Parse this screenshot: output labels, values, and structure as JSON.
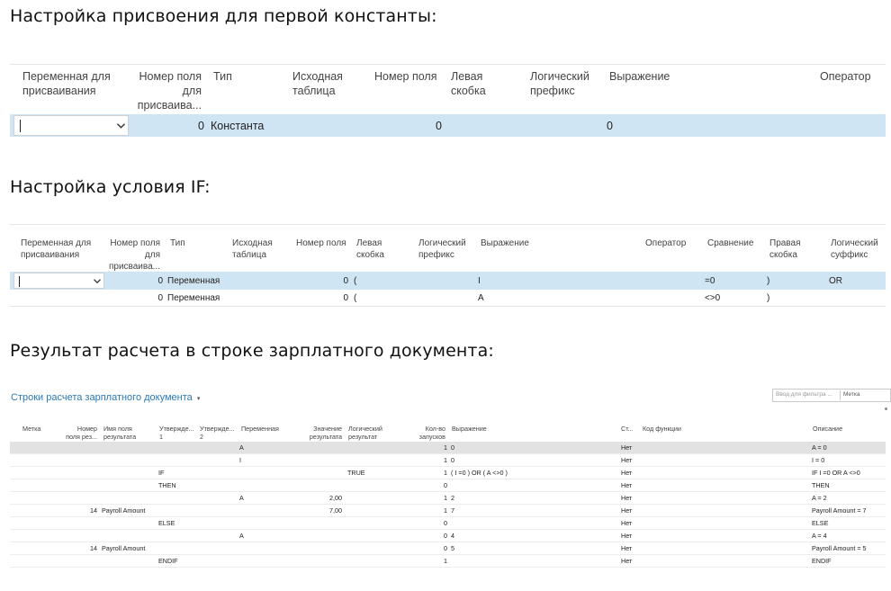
{
  "section1": {
    "heading": "Настройка присвоения для первой константы:",
    "headers": {
      "col1": "Переменная для\nприсваивания",
      "col2": "Номер поля\nдля\nприсваива...",
      "col3": "Тип",
      "col4": "Исходная\nтаблица",
      "col5": "Номер поля",
      "col6": "Левая\nскобка",
      "col7": "Логический\nпрефикс",
      "col8": "Выражение",
      "col9": "Оператор"
    },
    "row": {
      "var": "",
      "field": "0",
      "type": "Константа",
      "field2": "0",
      "expr": "0"
    }
  },
  "section2": {
    "heading": "Настройка условия IF:",
    "headers": {
      "col1": "Переменная для\nприсваивания",
      "col2": "Номер поля\nдля\nприсваива...",
      "col3": "Тип",
      "col4": "Исходная\nтаблица",
      "col5": "Номер поля",
      "col6": "Левая\nскобка",
      "col7": "Логический\nпрефикс",
      "col8": "Выражение",
      "col9": "Оператор",
      "col10": "Сравнение",
      "col11": "Правая\nскобка",
      "col12": "Логический\nсуффикс"
    },
    "rows": [
      {
        "var": "",
        "field": "0",
        "type": "Переменная",
        "field2": "0",
        "lbr": "(",
        "expr": "I",
        "cmp": "=0",
        "rbr": ")",
        "suffix": "OR"
      },
      {
        "var": "",
        "field": "0",
        "type": "Переменная",
        "field2": "0",
        "lbr": "(",
        "expr": "A",
        "cmp": "<>0",
        "rbr": ")",
        "suffix": ""
      }
    ]
  },
  "section3": {
    "heading": "Результат расчета в строке зарплатного документа:",
    "link": "Строки расчета зарплатного документа",
    "filter_placeholder": "Ввод для фильтра ...",
    "filter_field": "Метка",
    "headers": {
      "mark": "Метка",
      "fieldno": "Номер\nполя рез...",
      "fieldname": "Имя поля\nрезультата",
      "stmt1": "Утвержде...\n1",
      "stmt2": "Утвержде...\n2",
      "variable": "Переменная",
      "value": "Значение\nрезультата",
      "logic": "Логический\nрезультат",
      "runs": "Кол-во\nзапусков",
      "expr": "Выражение",
      "st": "Ст...",
      "func": "Код функции",
      "desc": "Описание"
    },
    "rows": [
      {
        "fieldno": "",
        "fieldname": "",
        "stmt1": "",
        "variable": "A",
        "value": "",
        "logic": "",
        "runs": "1",
        "expr": "0",
        "st": "Нет",
        "desc": "A = 0"
      },
      {
        "fieldno": "",
        "fieldname": "",
        "stmt1": "",
        "variable": "I",
        "value": "",
        "logic": "",
        "runs": "1",
        "expr": "0",
        "st": "Нет",
        "desc": "I = 0"
      },
      {
        "fieldno": "",
        "fieldname": "",
        "stmt1": "IF",
        "variable": "",
        "value": "",
        "logic": "TRUE",
        "runs": "1",
        "expr": "( I =0 ) OR ( A <>0 )",
        "st": "Нет",
        "desc": "IF I =0 OR A <>0"
      },
      {
        "fieldno": "",
        "fieldname": "",
        "stmt1": "THEN",
        "variable": "",
        "value": "",
        "logic": "",
        "runs": "0",
        "expr": "",
        "st": "Нет",
        "desc": "THEN"
      },
      {
        "fieldno": "",
        "fieldname": "",
        "stmt1": "",
        "variable": "A",
        "value": "2,00",
        "logic": "",
        "runs": "1",
        "expr": "2",
        "st": "Нет",
        "desc": "A = 2"
      },
      {
        "fieldno": "14",
        "fieldname": "Payroll Amount",
        "stmt1": "",
        "variable": "",
        "value": "7,00",
        "logic": "",
        "runs": "1",
        "expr": "7",
        "st": "Нет",
        "desc": "Payroll Amount = 7"
      },
      {
        "fieldno": "",
        "fieldname": "",
        "stmt1": "ELSE",
        "variable": "",
        "value": "",
        "logic": "",
        "runs": "0",
        "expr": "",
        "st": "Нет",
        "desc": "ELSE"
      },
      {
        "fieldno": "",
        "fieldname": "",
        "stmt1": "",
        "variable": "A",
        "value": "",
        "logic": "",
        "runs": "0",
        "expr": "4",
        "st": "Нет",
        "desc": "A = 4"
      },
      {
        "fieldno": "14",
        "fieldname": "Payroll Amount",
        "stmt1": "",
        "variable": "",
        "value": "",
        "logic": "",
        "runs": "0",
        "expr": "5",
        "st": "Нет",
        "desc": "Payroll Amount = 5"
      },
      {
        "fieldno": "",
        "fieldname": "",
        "stmt1": "ENDIF",
        "variable": "",
        "value": "",
        "logic": "",
        "runs": "1",
        "expr": "",
        "st": "Нет",
        "desc": "ENDIF"
      }
    ]
  },
  "colors": {
    "selection": "#cfe5f3",
    "link": "#2a7ab8",
    "highlight_row": "#e2e2e2"
  }
}
